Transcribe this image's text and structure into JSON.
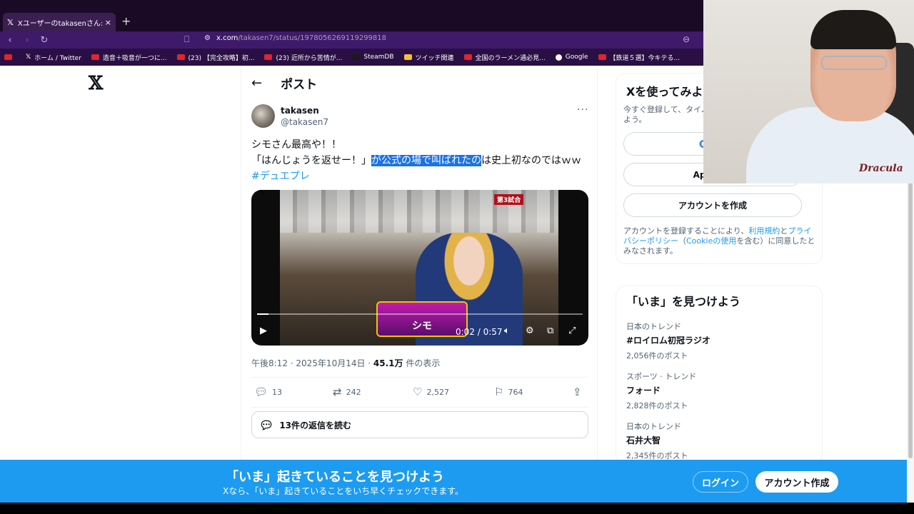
{
  "browser": {
    "tab_title": "Xユーザーのtakasenさん:「シモさん最",
    "tab_close": "×",
    "new_tab": "+",
    "url_host": "x.com",
    "url_path": "/takasen7/status/1978056269119299818",
    "bookmarks": [
      {
        "label": "",
        "color": "#e0252f"
      },
      {
        "label": "ホーム / Twitter",
        "color": "#ffffff"
      },
      {
        "label": "造音＋吸音が一つに...",
        "color": "#e0252f"
      },
      {
        "label": "(23) 【完全攻略】初...",
        "color": "#e0252f"
      },
      {
        "label": "(23) 近所から苦情が...",
        "color": "#e0252f"
      },
      {
        "label": "SteamDB",
        "color": "#1a1a1a"
      },
      {
        "label": "ツイッチ関連",
        "color": "#f4c430"
      },
      {
        "label": "全国のラーメン通必見...",
        "color": "#e0252f"
      },
      {
        "label": "Google",
        "color": "#ffffff"
      },
      {
        "label": "【鉄道５選】今キテる...",
        "color": "#e0252f"
      }
    ]
  },
  "page": {
    "logo": "𝕏",
    "header": {
      "back": "←",
      "title": "ポスト"
    },
    "author": {
      "name": "takasen",
      "handle": "@takasen7",
      "more": "···"
    },
    "tweet": {
      "line1": "シモさん最高や！！",
      "line2_before": "「はんじょうを返せー！」",
      "line2_highlight": "が公式の場で叫ばれたの",
      "line2_after": "は史上初なのではｗｗ",
      "hashtag": "#デュエプレ"
    },
    "video": {
      "badge": "第3試合",
      "caption": "シモ",
      "time": "0:02 / 0:57",
      "progress": 0.035
    },
    "timestamp": "午後8:12 · 2025年10月14日 · ",
    "views": "45.1万",
    "views_suffix": " 件の表示",
    "actions": {
      "replies": "13",
      "reposts": "242",
      "likes": "2,527",
      "bookmarks": "764"
    },
    "read_replies": "13件の返信を読む"
  },
  "sidebar": {
    "signup": {
      "title": "Xを使ってみよ",
      "subtitle": "今すぐ登録して、タイム\nよう。",
      "google": "Go",
      "apple": "Appleのア",
      "create": "アカウントを作成",
      "terms_1": "アカウントを登録することにより、",
      "terms_link1": "利用規約",
      "terms_2": "と",
      "terms_link2": "プライバシーポリシー",
      "terms_3": "（",
      "terms_link3": "Cookieの使用",
      "terms_4": "を含む）に同意したとみなされます。"
    },
    "trends": {
      "title": "「いま」を見つけよう",
      "items": [
        {
          "category": "日本のトレンド",
          "name": "#ロイロム初冠ラジオ",
          "count": "2,056件のポスト"
        },
        {
          "category": "スポーツ · トレンド",
          "name": "フォード",
          "count": "2,828件のポスト"
        },
        {
          "category": "日本のトレンド",
          "name": "石井大智",
          "count": "2,345件のポスト"
        }
      ]
    }
  },
  "banner": {
    "title": "「いま」起きていることを見つけよう",
    "subtitle": "Xなら、「いま」起きていることをいち早くチェックできます。",
    "login": "ログイン",
    "create": "アカウント作成"
  },
  "webcam": {
    "shirt_text": "Dracula"
  },
  "colors": {
    "accent": "#1d9bf0",
    "highlight": "#1a73e8",
    "text": "#0f1419",
    "muted": "#536471"
  }
}
